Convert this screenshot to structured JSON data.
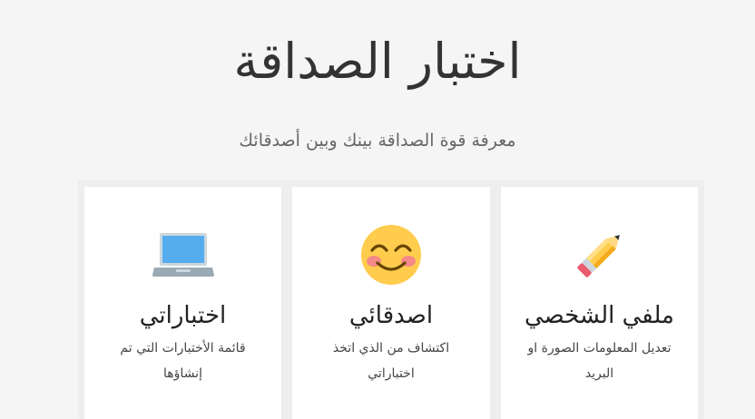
{
  "header": {
    "title": "اختبار الصداقة",
    "subtitle": "معرفة قوة الصداقة بينك وبين أصدقائك"
  },
  "cards": [
    {
      "icon": "pencil-icon",
      "title": "ملفي الشخصي",
      "description": "تعديل المعلومات الصورة او البريد"
    },
    {
      "icon": "smiling-face-icon",
      "title": "اصدقائي",
      "description": "اكتشاف من الذي اتخذ اختباراتي"
    },
    {
      "icon": "laptop-icon",
      "title": "اختباراتي",
      "description": "قائمة الأختبارات التي تم إنشاؤها"
    }
  ]
}
